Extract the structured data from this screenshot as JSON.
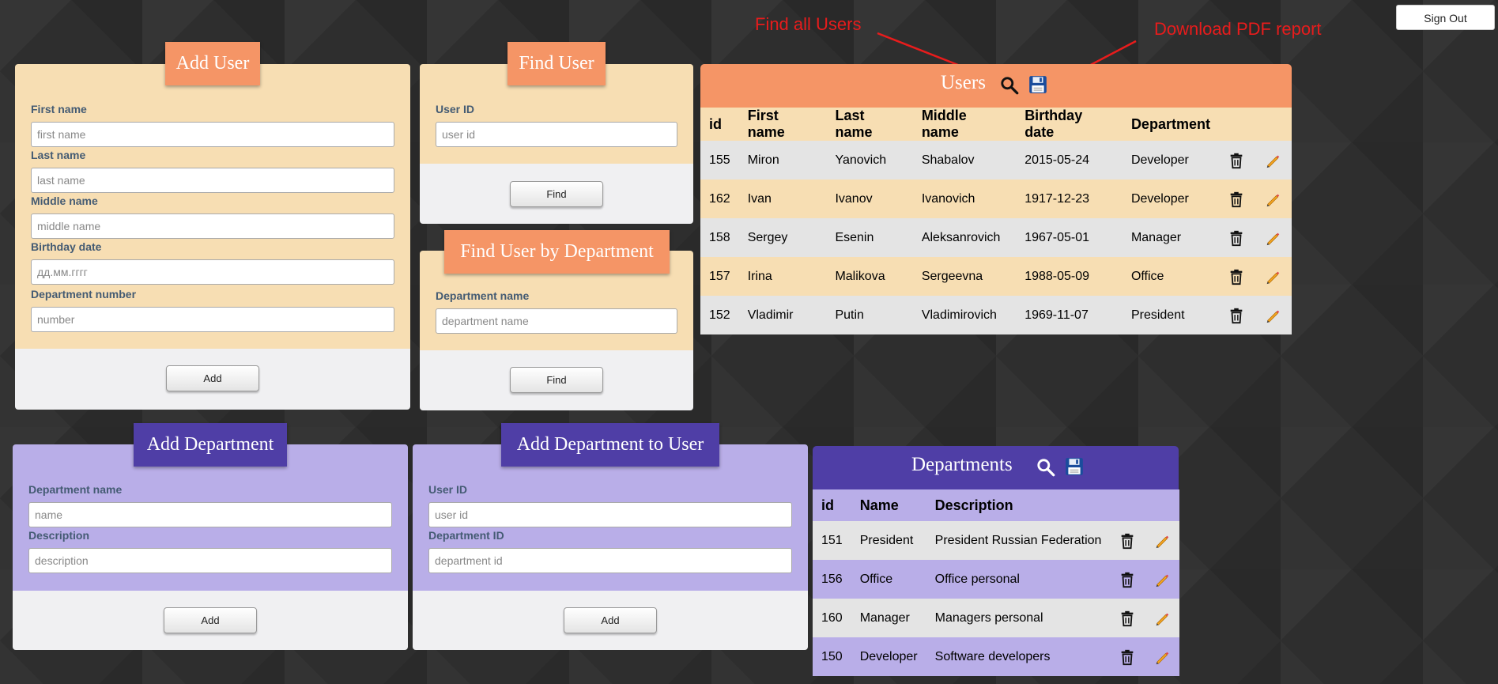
{
  "header": {
    "sign_out": "Sign Out"
  },
  "annotations": {
    "find_all": "Find all Users",
    "download_pdf": "Download PDF report"
  },
  "add_user": {
    "title": "Add User",
    "first_name_label": "First name",
    "first_name_placeholder": "first name",
    "last_name_label": "Last name",
    "last_name_placeholder": "last name",
    "middle_name_label": "Middle name",
    "middle_name_placeholder": "middle name",
    "birthday_label": "Birthday date",
    "birthday_placeholder": "дд.мм.гггг",
    "department_label": "Department number",
    "department_placeholder": "number",
    "button": "Add"
  },
  "find_user": {
    "title": "Find User",
    "user_id_label": "User ID",
    "user_id_placeholder": "user id",
    "button": "Find"
  },
  "find_by_department": {
    "title": "Find User by Department",
    "department_label": "Department name",
    "department_placeholder": "department name",
    "button": "Find"
  },
  "add_department": {
    "title": "Add Department",
    "name_label": "Department name",
    "name_placeholder": "name",
    "description_label": "Description",
    "description_placeholder": "description",
    "button": "Add"
  },
  "add_department_to_user": {
    "title": "Add Department to User",
    "user_id_label": "User ID",
    "user_id_placeholder": "user id",
    "department_id_label": "Department ID",
    "department_id_placeholder": "department id",
    "button": "Add"
  },
  "users": {
    "title": "Users",
    "columns": [
      "id",
      "First name",
      "Last name",
      "Middle name",
      "Birthday date",
      "Department"
    ],
    "rows": [
      [
        "155",
        "Miron",
        "Yanovich",
        "Shabalov",
        "2015-05-24",
        "Developer"
      ],
      [
        "162",
        "Ivan",
        "Ivanov",
        "Ivanovich",
        "1917-12-23",
        "Developer"
      ],
      [
        "158",
        "Sergey",
        "Esenin",
        "Aleksanrovich",
        "1967-05-01",
        "Manager"
      ],
      [
        "157",
        "Irina",
        "Malikova",
        "Sergeevna",
        "1988-05-09",
        "Office"
      ],
      [
        "152",
        "Vladimir",
        "Putin",
        "Vladimirovich",
        "1969-11-07",
        "President"
      ]
    ]
  },
  "departments": {
    "title": "Departments",
    "columns": [
      "id",
      "Name",
      "Description"
    ],
    "rows": [
      [
        "151",
        "President",
        "President Russian Federation"
      ],
      [
        "156",
        "Office",
        "Office personal"
      ],
      [
        "160",
        "Manager",
        "Managers personal"
      ],
      [
        "150",
        "Developer",
        "Software developers"
      ]
    ]
  },
  "colors": {
    "orange": "#f59566",
    "peach": "#f7deb3",
    "purple": "#4f3ea6",
    "lavender": "#b9aee8",
    "annotation": "#e81c1c"
  }
}
